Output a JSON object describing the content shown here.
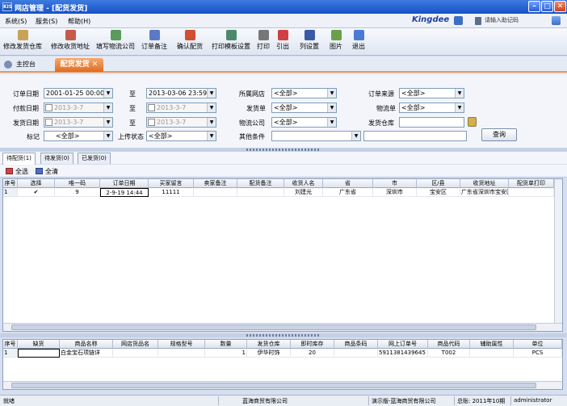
{
  "window": {
    "title": "网店管理 - [配货发货]",
    "app_icon": "KIS"
  },
  "menu": [
    "系统(S)",
    "服务(S)",
    "帮助(H)"
  ],
  "brand": {
    "logo": "Kingdee",
    "help_placeholder": "请输入助记码"
  },
  "toolbar": [
    {
      "label": "修改发货仓库",
      "icon": "edit-warehouse-icon"
    },
    {
      "label": "修改收货地址",
      "icon": "edit-address-icon"
    },
    {
      "label": "填写物流公司",
      "icon": "logistics-icon"
    },
    {
      "label": "订单备注",
      "icon": "order-note-icon"
    },
    {
      "label": "确认配货",
      "icon": "confirm-icon"
    },
    {
      "label": "打印模板设置",
      "icon": "print-template-icon"
    },
    {
      "label": "打印",
      "icon": "print-icon"
    },
    {
      "label": "引出",
      "icon": "export-icon"
    },
    {
      "label": "列设置",
      "icon": "column-settings-icon"
    },
    {
      "label": "图片",
      "icon": "image-icon"
    },
    {
      "label": "退出",
      "icon": "exit-icon"
    }
  ],
  "tabs": {
    "home": "主控台",
    "active": "配货发货"
  },
  "filters": {
    "order_date_label": "订单日期",
    "order_date_from": "2001-01-25 00:00",
    "to": "至",
    "order_date_to": "2013-03-06 23:59",
    "pay_date_label": "付款日期",
    "pay_date_from": "2013-3-7",
    "pay_date_to": "2013-3-7",
    "ship_date_label": "发货日期",
    "ship_date_from": "2013-3-7",
    "ship_date_to": "2013-3-7",
    "mark_label": "标记",
    "mark_value": "<全部>",
    "upload_label": "上传状态",
    "upload_value": "<全部>",
    "shop_label": "所属网店",
    "shop_value": "<全部>",
    "invoice_label": "发货单",
    "invoice_value": "<全部>",
    "logistics_label": "物流公司",
    "logistics_value": "<全部>",
    "other_label": "其他条件",
    "source_label": "订单来源",
    "source_value": "<全部>",
    "waybill_label": "物流单",
    "waybill_value": "<全部>",
    "warehouse_label": "发货仓库",
    "query_button": "查询"
  },
  "subtabs": [
    "待配货(1)",
    "待发货(0)",
    "已发货(0)"
  ],
  "select_tools": {
    "select_all": "全选",
    "clear_all": "全清"
  },
  "grid1": {
    "headers": [
      "序号",
      "选择",
      "唯一码",
      "订单日期",
      "买家留言",
      "卖家备注",
      "配货备注",
      "收货人名",
      "省",
      "市",
      "区/县",
      "收货地址",
      "配货单打印"
    ],
    "rows": [
      [
        "1",
        "✔",
        "9",
        "2-9-19 14:44",
        "11111",
        "",
        "",
        "刘建光",
        "广东省",
        "深圳市",
        "宝安区",
        "广东省深圳市宝安区南苑",
        ""
      ]
    ]
  },
  "grid2": {
    "headers": [
      "序号",
      "缺货",
      "商品名称",
      "网店货品名",
      "规格型号",
      "数量",
      "发货仓库",
      "即时库存",
      "商品条码",
      "网上订单号",
      "商品代码",
      "辅助属性",
      "单位"
    ],
    "rows": [
      [
        "1",
        "",
        "白金宝石项链详",
        "",
        "",
        "1",
        "伊华时饰",
        "20",
        "",
        "5911381439645",
        "T002",
        "",
        "PCS"
      ]
    ]
  },
  "status": {
    "left": "就绪",
    "company": "蓝海商贸有限公司",
    "demo": "演示版-蓝海商贸有限公司",
    "period": "总账: 2011年10期",
    "user": "administrator"
  }
}
